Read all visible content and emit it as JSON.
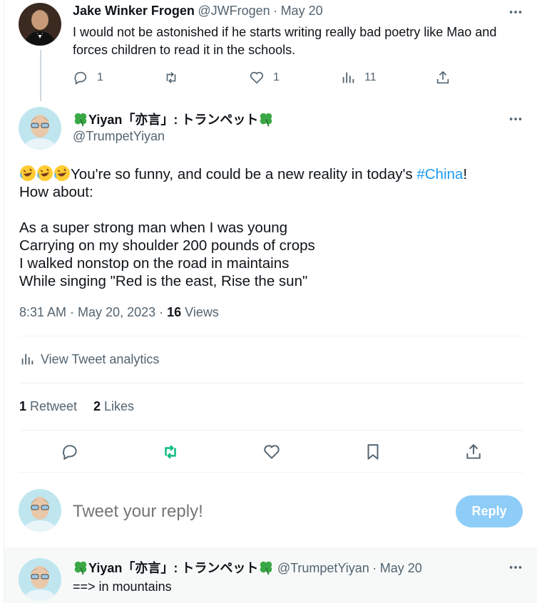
{
  "reply_parent": {
    "author_name": "Jake Winker Frogen",
    "handle": "@JWFrogen",
    "date": "May 20",
    "separator": "·",
    "text": "I would not be astonished if he starts writing really bad poetry like Mao and forces children to read it in the schools.",
    "replies": "1",
    "likes": "1",
    "views": "11"
  },
  "main_tweet": {
    "author_name": "Yiyan「亦言」: トランペット",
    "handle": "@TrumpetYiyan",
    "text_before_tag": "You're so funny, and could be a new reality in today's ",
    "hashtag": "#China",
    "text_after_tag": "!",
    "line2": "How about:",
    "poem": [
      "As a super strong man when I was young",
      "Carrying on my shoulder 200 pounds of crops",
      "I walked nonstop on the road in maintains",
      "While singing \"Red is the east, Rise the sun\""
    ],
    "time": "8:31 AM · May 20, 2023 · ",
    "views_count": "16",
    "views_label": " Views",
    "analytics_label": "View Tweet analytics",
    "retweets_count": "1",
    "retweets_label": " Retweet",
    "likes_count": "2",
    "likes_label": " Likes"
  },
  "compose": {
    "placeholder": "Tweet your reply!",
    "reply_button": "Reply"
  },
  "reply_child": {
    "author_name": "Yiyan「亦言」: トランペット",
    "handle": "@TrumpetYiyan",
    "separator": "·",
    "date": "May 20",
    "text": "==> in mountains"
  },
  "colors": {
    "accent": "#1d9bf0",
    "retweet_green": "#00ba7c",
    "muted": "#536471",
    "reply_button_disabled": "#8ecdf8"
  }
}
